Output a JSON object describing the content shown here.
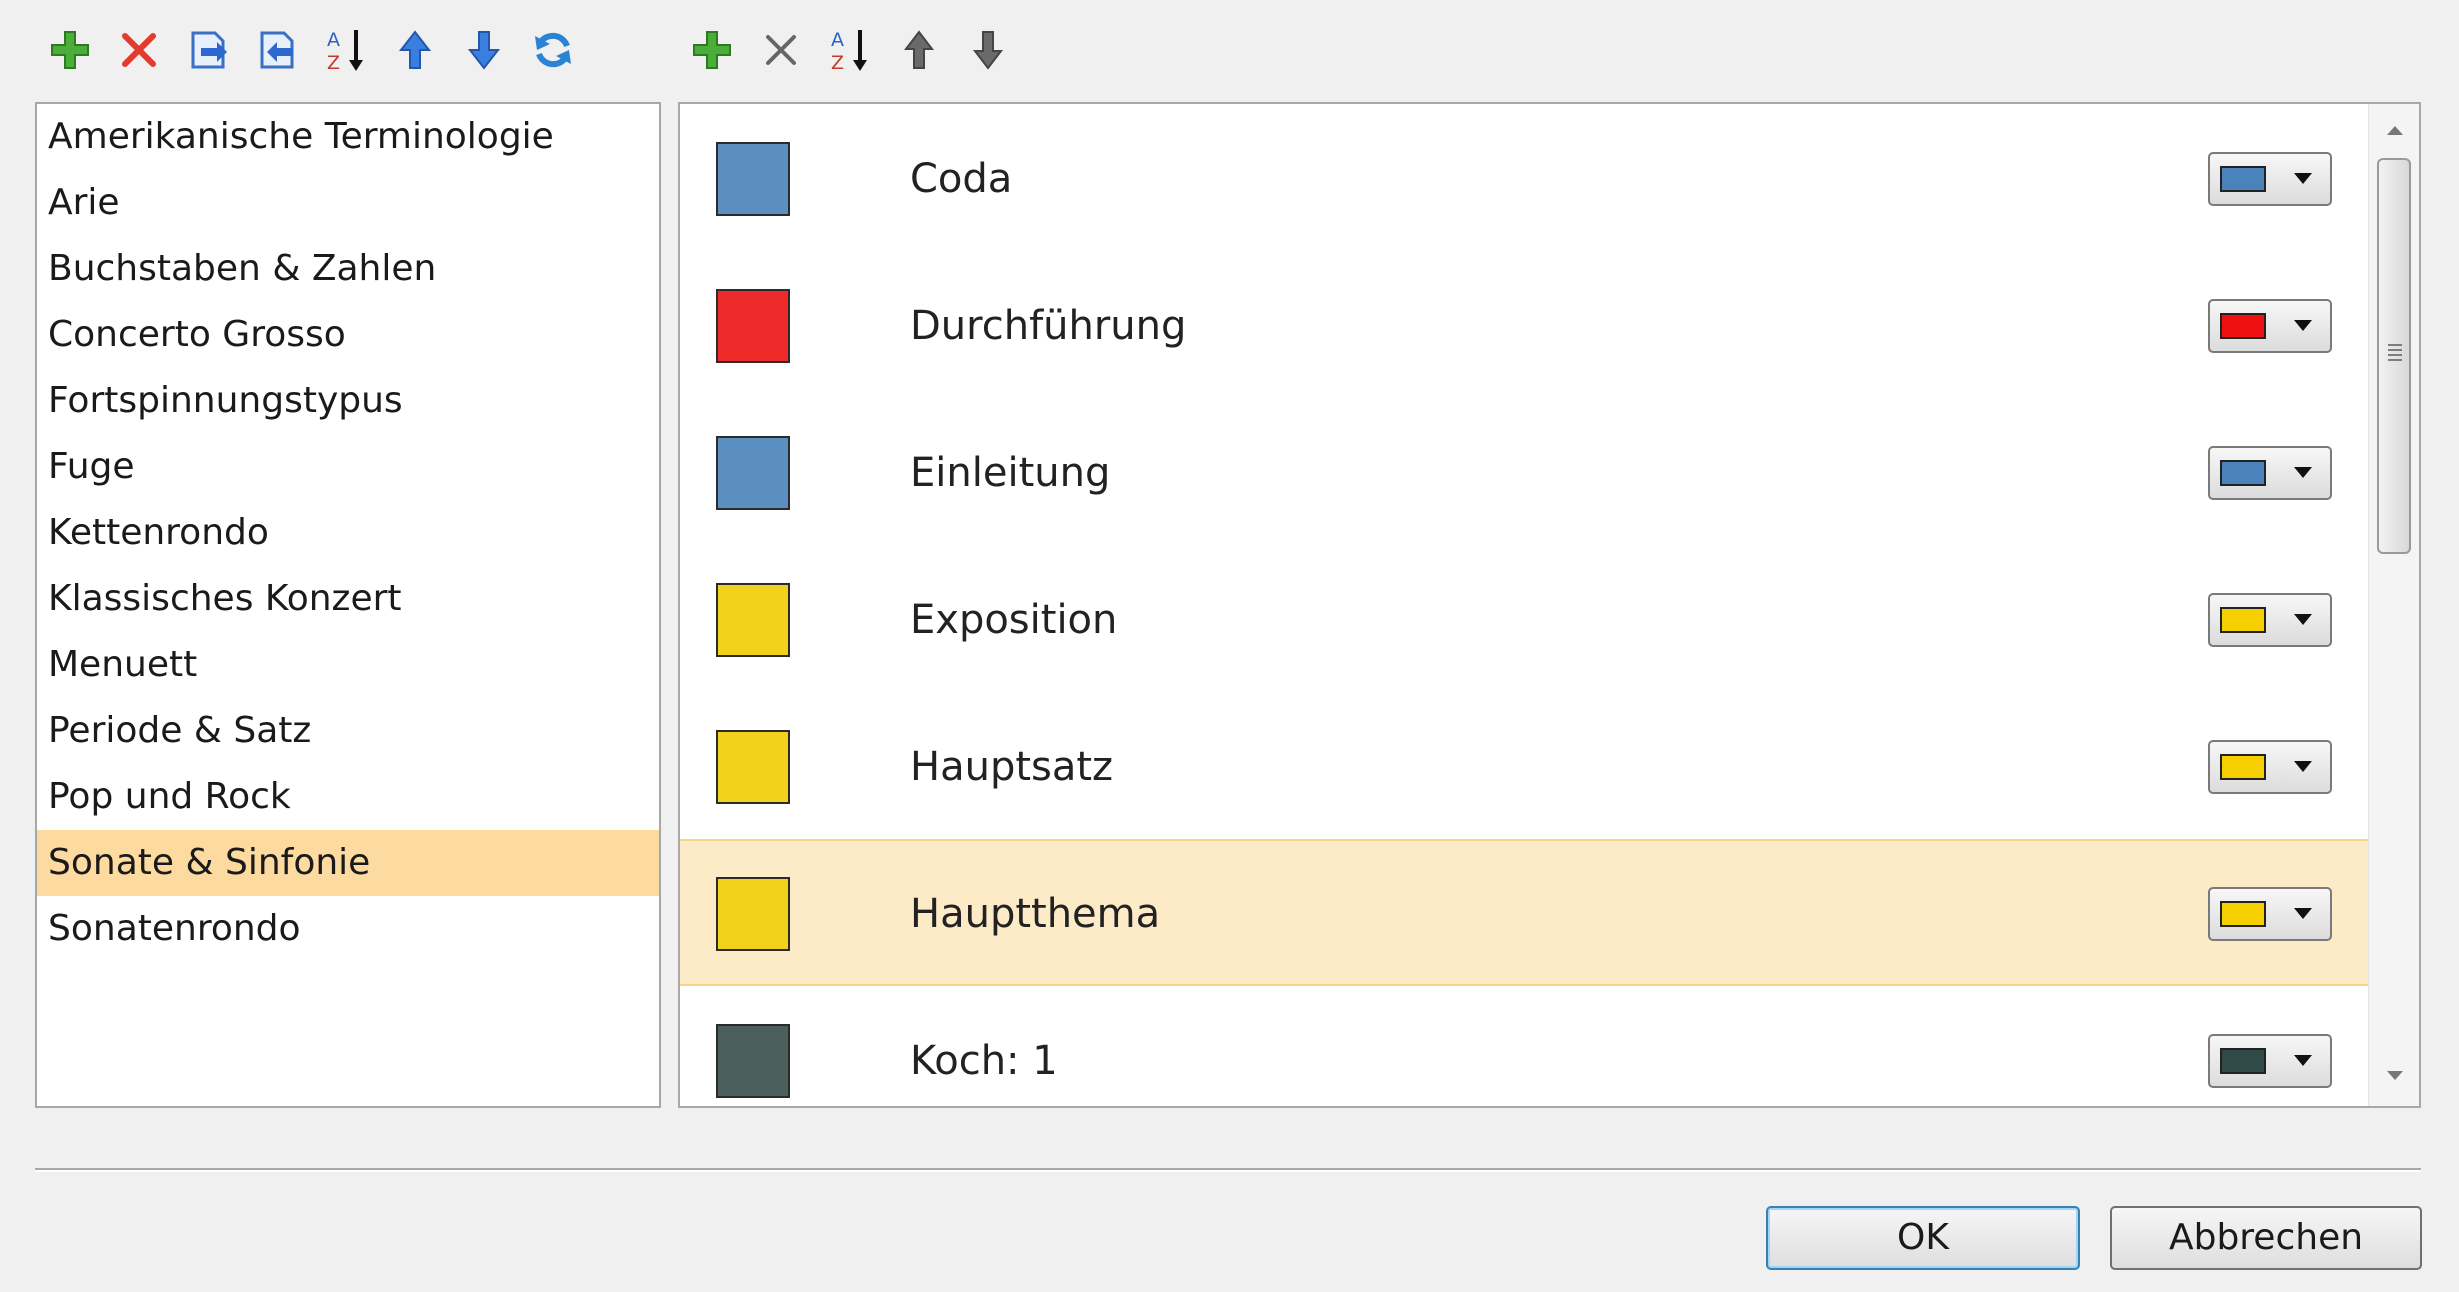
{
  "left_toolbar": [
    {
      "icon": "add-icon"
    },
    {
      "icon": "delete-icon"
    },
    {
      "icon": "export-icon"
    },
    {
      "icon": "import-icon"
    },
    {
      "icon": "sort-az-icon",
      "text": [
        "A",
        "Z"
      ]
    },
    {
      "icon": "move-up-icon"
    },
    {
      "icon": "move-down-icon"
    },
    {
      "icon": "refresh-icon"
    }
  ],
  "right_toolbar": [
    {
      "icon": "add-icon"
    },
    {
      "icon": "delete-icon"
    },
    {
      "icon": "sort-az-icon",
      "text": [
        "A",
        "Z"
      ]
    },
    {
      "icon": "move-up-icon"
    },
    {
      "icon": "move-down-icon"
    }
  ],
  "templates": [
    "Amerikanische Terminologie",
    "Arie",
    "Buchstaben & Zahlen",
    "Concerto Grosso",
    "Fortspinnungstypus",
    "Fuge",
    "Kettenrondo",
    "Klassisches Konzert",
    "Menuett",
    "Periode & Satz",
    "Pop und Rock",
    "Sonate & Sinfonie",
    "Sonatenrondo"
  ],
  "selected_template": "Sonate & Sinfonie",
  "sections": [
    {
      "label": "Coda",
      "color": "#5b8fc0",
      "picker_color": "#4a82bb"
    },
    {
      "label": "Durchführung",
      "color": "#ee2a2a",
      "picker_color": "#ee1111"
    },
    {
      "label": "Einleitung",
      "color": "#5b8fc0",
      "picker_color": "#4a82bb"
    },
    {
      "label": "Exposition",
      "color": "#f3d21c",
      "picker_color": "#f5cf00"
    },
    {
      "label": "Hauptsatz",
      "color": "#f3d21c",
      "picker_color": "#f5cf00"
    },
    {
      "label": "Hauptthema",
      "color": "#f3d21c",
      "picker_color": "#f5cf00"
    },
    {
      "label": "Koch: 1",
      "color": "#4d5f5c",
      "picker_color": "#2f4a47"
    }
  ],
  "selected_section": "Hauptthema",
  "buttons": {
    "ok": "OK",
    "cancel": "Abbrechen"
  }
}
